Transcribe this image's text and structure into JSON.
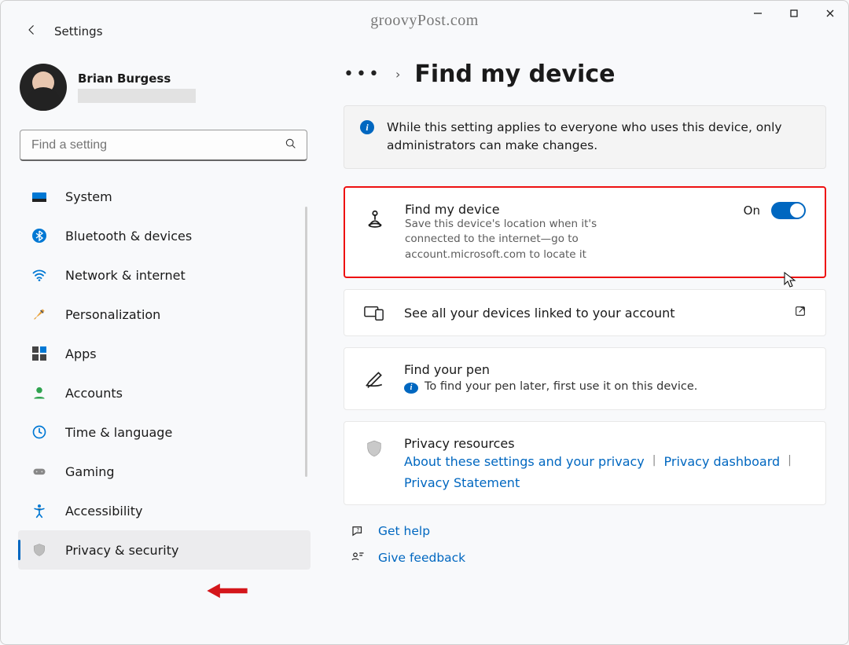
{
  "window": {
    "watermark": "groovyPost.com"
  },
  "topbar": {
    "app_title": "Settings"
  },
  "profile": {
    "name": "Brian Burgess"
  },
  "search": {
    "placeholder": "Find a setting"
  },
  "nav": {
    "items": [
      {
        "label": "System"
      },
      {
        "label": "Bluetooth & devices"
      },
      {
        "label": "Network & internet"
      },
      {
        "label": "Personalization"
      },
      {
        "label": "Apps"
      },
      {
        "label": "Accounts"
      },
      {
        "label": "Time & language"
      },
      {
        "label": "Gaming"
      },
      {
        "label": "Accessibility"
      },
      {
        "label": "Privacy & security"
      }
    ]
  },
  "page": {
    "title": "Find my device",
    "info_banner": "While this setting applies to everyone who uses this device, only administrators can make changes.",
    "find_card": {
      "title": "Find my device",
      "sub": "Save this device's location when it's connected to the internet—go to account.microsoft.com to locate it",
      "state_label": "On"
    },
    "devices_card": {
      "title": "See all your devices linked to your account"
    },
    "pen_card": {
      "title": "Find your pen",
      "sub": "To find your pen later, first use it on this device."
    },
    "privacy_card": {
      "title": "Privacy resources",
      "links": [
        "About these settings and your privacy",
        "Privacy dashboard",
        "Privacy Statement"
      ]
    },
    "footer": {
      "help": "Get help",
      "feedback": "Give feedback"
    }
  }
}
